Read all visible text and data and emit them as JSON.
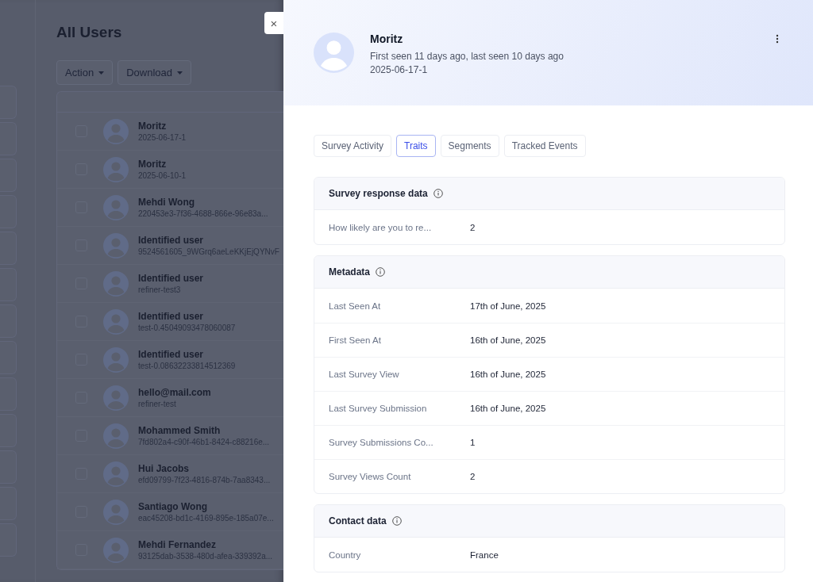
{
  "page": {
    "title": "All Users",
    "actions": [
      {
        "label": "Action"
      },
      {
        "label": "Download"
      }
    ]
  },
  "users": [
    {
      "name": "Moritz",
      "id": "2025-06-17-1",
      "checked": false
    },
    {
      "name": "Moritz",
      "id": "2025-06-10-1",
      "checked": false
    },
    {
      "name": "Mehdi Wong",
      "id": "220453e3-7f36-4688-866e-96e83a...",
      "checked": false
    },
    {
      "name": "Identified user",
      "id": "9524561605_9WGrq6aeLeKKjEjQYNvF",
      "checked": false
    },
    {
      "name": "Identified user",
      "id": "refiner-test3",
      "checked": false
    },
    {
      "name": "Identified user",
      "id": "test-0.45049093478060087",
      "checked": false
    },
    {
      "name": "Identified user",
      "id": "test-0.08632233814512369",
      "checked": false
    },
    {
      "name": "hello@mail.com",
      "id": "refiner-test",
      "checked": false
    },
    {
      "name": "Mohammed Smith",
      "id": "7fd802a4-c90f-46b1-8424-c88216e...",
      "checked": false
    },
    {
      "name": "Hui Jacobs",
      "id": "efd09799-7f23-4816-874b-7aa8343...",
      "checked": false
    },
    {
      "name": "Santiago Wong",
      "id": "eac45208-bd1c-4169-895e-185a07e...",
      "checked": false
    },
    {
      "name": "Mehdi Fernandez",
      "id": "93125dab-3538-480d-afea-339392a...",
      "checked": false
    }
  ],
  "drawer": {
    "close": "×",
    "name": "Moritz",
    "seen": "First seen 11 days ago, last seen 10 days ago",
    "id": "2025-06-17-1",
    "tabs": [
      {
        "label": "Survey Activity",
        "selected": false
      },
      {
        "label": "Traits",
        "selected": true
      },
      {
        "label": "Segments",
        "selected": false
      },
      {
        "label": "Tracked Events",
        "selected": false
      }
    ],
    "sections": [
      {
        "title": "Survey response data",
        "rows": [
          {
            "label": "How likely are you to re...",
            "value": "2"
          }
        ]
      },
      {
        "title": "Metadata",
        "rows": [
          {
            "label": "Last Seen At",
            "value": "17th of June, 2025"
          },
          {
            "label": "First Seen At",
            "value": "16th of June, 2025"
          },
          {
            "label": "Last Survey View",
            "value": "16th of June, 2025"
          },
          {
            "label": "Last Survey Submission",
            "value": "16th of June, 2025"
          },
          {
            "label": "Survey Submissions Co...",
            "value": "1"
          },
          {
            "label": "Survey Views Count",
            "value": "2"
          }
        ]
      },
      {
        "title": "Contact data",
        "rows": [
          {
            "label": "Country",
            "value": "France"
          }
        ]
      }
    ]
  }
}
